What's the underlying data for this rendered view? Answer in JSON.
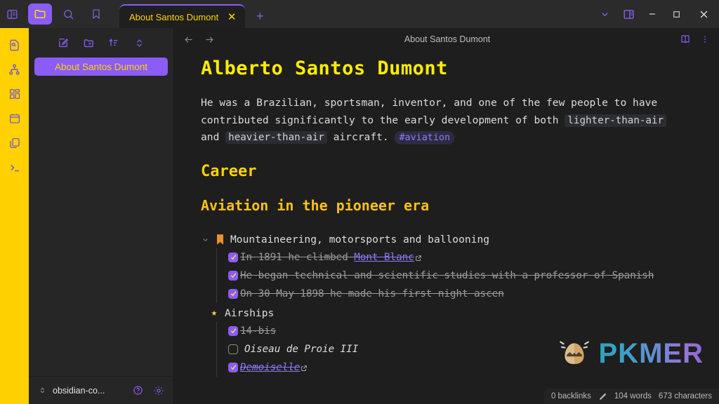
{
  "theme": {
    "accent_purple": "#8b5cf6",
    "accent_yellow": "#ffd400",
    "heading_yellow": "#ffee00",
    "ribbon_yellow": "#ffd100",
    "bg_dark": "#1e1e1e",
    "sidebar_bg": "#262626",
    "titlebar_bg": "#2b2b2b"
  },
  "titlebar": {
    "icons": [
      {
        "name": "toggle-left-sidebar-icon",
        "label": "Toggle left sidebar",
        "active": false
      },
      {
        "name": "folder-icon",
        "label": "Files",
        "active": true
      },
      {
        "name": "search-icon",
        "label": "Search",
        "active": false
      },
      {
        "name": "bookmark-icon",
        "label": "Bookmarks",
        "active": false
      }
    ],
    "tabs": [
      {
        "title": "About Santos Dumont",
        "active": true,
        "close_label": "✕"
      }
    ],
    "new_tab_label": "+",
    "window_controls": [
      {
        "name": "tab-list-chevron-icon",
        "label": "⌄"
      },
      {
        "name": "toggle-right-sidebar-icon",
        "label": "Toggle right sidebar"
      },
      {
        "name": "minimize-button",
        "label": "—"
      },
      {
        "name": "maximize-button",
        "label": "□"
      },
      {
        "name": "close-button",
        "label": "✕"
      }
    ]
  },
  "ribbon": {
    "items": [
      {
        "name": "quick-switcher-icon",
        "label": "Open quick switcher"
      },
      {
        "name": "graph-view-icon",
        "label": "Open graph view"
      },
      {
        "name": "plugins-grid-icon",
        "label": "Plugins"
      },
      {
        "name": "calendar-icon",
        "label": "Calendar"
      },
      {
        "name": "copy-pages-icon",
        "label": "Duplicate page"
      },
      {
        "name": "terminal-icon",
        "label": "Terminal"
      }
    ]
  },
  "sidebar": {
    "toolbar": [
      {
        "name": "new-note-icon",
        "label": "New note"
      },
      {
        "name": "new-folder-icon",
        "label": "New folder"
      },
      {
        "name": "sort-order-icon",
        "label": "Change sort order"
      },
      {
        "name": "collapse-all-icon",
        "label": "Collapse all"
      }
    ],
    "files": [
      {
        "name": "file-item-about-santos-dumont",
        "label": "About Santos Dumont",
        "active": true
      }
    ],
    "bottom": {
      "vault_name": "obsidian-co...",
      "help_label": "Help",
      "settings_label": "Settings"
    }
  },
  "view": {
    "back_label": "←",
    "forward_label": "→",
    "title": "About Santos Dumont",
    "reading_mode_label": "Reading view",
    "more_options_label": "More options"
  },
  "note": {
    "h1": "Alberto Santos Dumont",
    "paragraph": {
      "part1": "He was a Brazilian, sportsman, inventor, and one of the few people to have contributed significantly to the early development of both ",
      "code1": "lighter-than-air",
      "part2": " and ",
      "code2": "heavier-than-air",
      "part3": " aircraft. ",
      "tag": "#aviation"
    },
    "h2": "Career",
    "h3": "Aviation in the pioneer era",
    "groups": [
      {
        "name": "list-group-mountaineering",
        "bullet": "bookmark-flag-bullet-icon",
        "label": "Mountaineering, motorsports and ballooning",
        "collapsible": true,
        "tasks": [
          {
            "name": "task-mont-blanc",
            "checked": true,
            "text_before": "In 1891 he climbed ",
            "link": "Mont Blanc",
            "has_external_icon": true,
            "text_after": ""
          },
          {
            "name": "task-technical-studies",
            "checked": true,
            "text_before": "He began technical and scientific studies with a professor of Spanish",
            "link": "",
            "has_external_icon": false,
            "text_after": ""
          },
          {
            "name": "task-first-night-ascent",
            "checked": true,
            "text_before": "On 30 May 1898 he made his first night ascen",
            "link": "",
            "has_external_icon": false,
            "text_after": ""
          }
        ]
      },
      {
        "name": "list-group-airships",
        "bullet": "star-bullet-icon",
        "label": "Airships",
        "collapsible": false,
        "tasks": [
          {
            "name": "task-14-bis",
            "checked": true,
            "text_before": "14-bis",
            "link": "",
            "has_external_icon": false,
            "text_after": ""
          },
          {
            "name": "task-oiseau-de-proie-iii",
            "checked": false,
            "text_before": "Oiseau de Proie III",
            "link": "",
            "has_external_icon": false,
            "text_after": ""
          },
          {
            "name": "task-demoiselle",
            "checked": true,
            "text_before": "",
            "link": "Demoiselle",
            "has_external_icon": true,
            "text_after": ""
          }
        ]
      }
    ]
  },
  "watermark": {
    "text": "PKMER",
    "logo_label": "pkmer-egg-logo"
  },
  "statusbar": {
    "backlinks": "0 backlinks",
    "edit_icon_label": "pencil-icon",
    "words": "104 words",
    "characters": "673 characters"
  }
}
